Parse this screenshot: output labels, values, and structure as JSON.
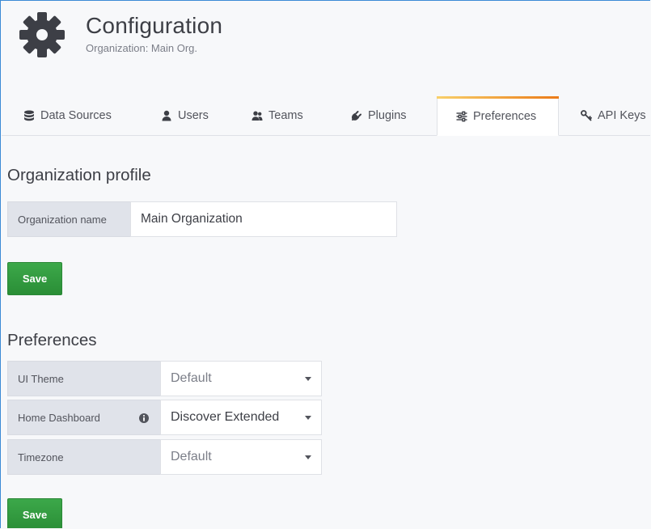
{
  "header": {
    "title": "Configuration",
    "subtitle": "Organization: Main Org.",
    "icon": "gear-icon"
  },
  "tabs": [
    {
      "label": "Data Sources",
      "icon": "database-icon",
      "active": false
    },
    {
      "label": "Users",
      "icon": "user-icon",
      "active": false
    },
    {
      "label": "Teams",
      "icon": "users-icon",
      "active": false
    },
    {
      "label": "Plugins",
      "icon": "plug-icon",
      "active": false
    },
    {
      "label": "Preferences",
      "icon": "sliders-icon",
      "active": true
    },
    {
      "label": "API Keys",
      "icon": "key-icon",
      "active": false
    }
  ],
  "org_profile": {
    "title": "Organization profile",
    "name_label": "Organization name",
    "name_value": "Main Organization",
    "save_label": "Save"
  },
  "preferences": {
    "title": "Preferences",
    "ui_theme_label": "UI Theme",
    "ui_theme_value": "Default",
    "home_dashboard_label": "Home Dashboard",
    "home_dashboard_value": "Discover Extended",
    "timezone_label": "Timezone",
    "timezone_value": "Default",
    "save_label": "Save"
  },
  "colors": {
    "accent_gradient_start": "#f8d06a",
    "accent_gradient_end": "#eb7b18",
    "save_green": "#3ca84a",
    "frame_blue": "#3b8bd6"
  }
}
